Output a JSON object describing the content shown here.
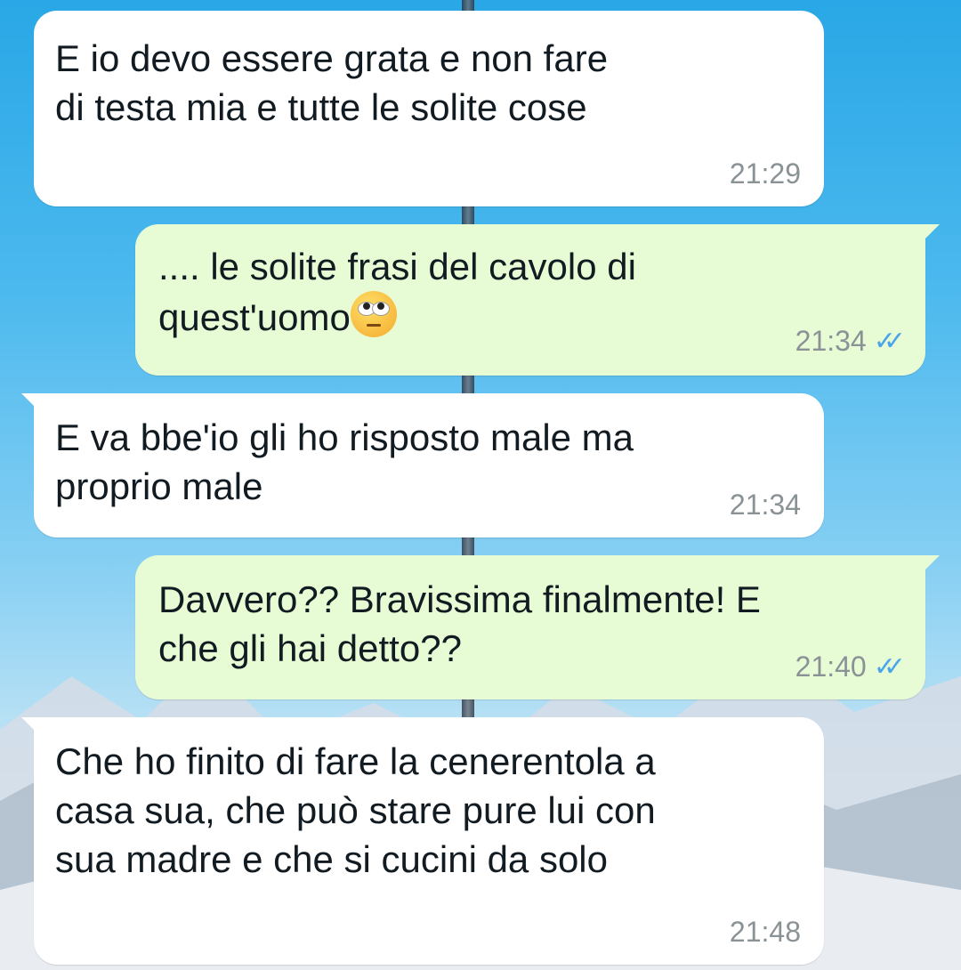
{
  "theme": {
    "incoming_bg": "#ffffff",
    "outgoing_bg": "#e7fcd5",
    "read_ticks_color": "#4aa5ea",
    "time_color": "#8a9296"
  },
  "messages": [
    {
      "direction": "incoming",
      "text": "E io devo essere grata e non fare\ndi testa mia e tutte le solite cose",
      "time": "21:29"
    },
    {
      "direction": "outgoing",
      "text": ".... le solite frasi del cavolo di\nquest'uomo",
      "emoji": "face-with-rolling-eyes-icon",
      "time": "21:34",
      "status": "read"
    },
    {
      "direction": "incoming",
      "text": "E va bbe'io gli ho risposto male ma\nproprio male",
      "time": "21:34"
    },
    {
      "direction": "outgoing",
      "text": "Davvero?? Bravissima  finalmente! E\nche gli hai detto??",
      "time": "21:40",
      "status": "read"
    },
    {
      "direction": "incoming",
      "text": "Che ho finito di fare la cenerentola a\ncasa sua, che può stare pure lui con\nsua madre e che si cucini da solo",
      "time": "21:48"
    }
  ]
}
